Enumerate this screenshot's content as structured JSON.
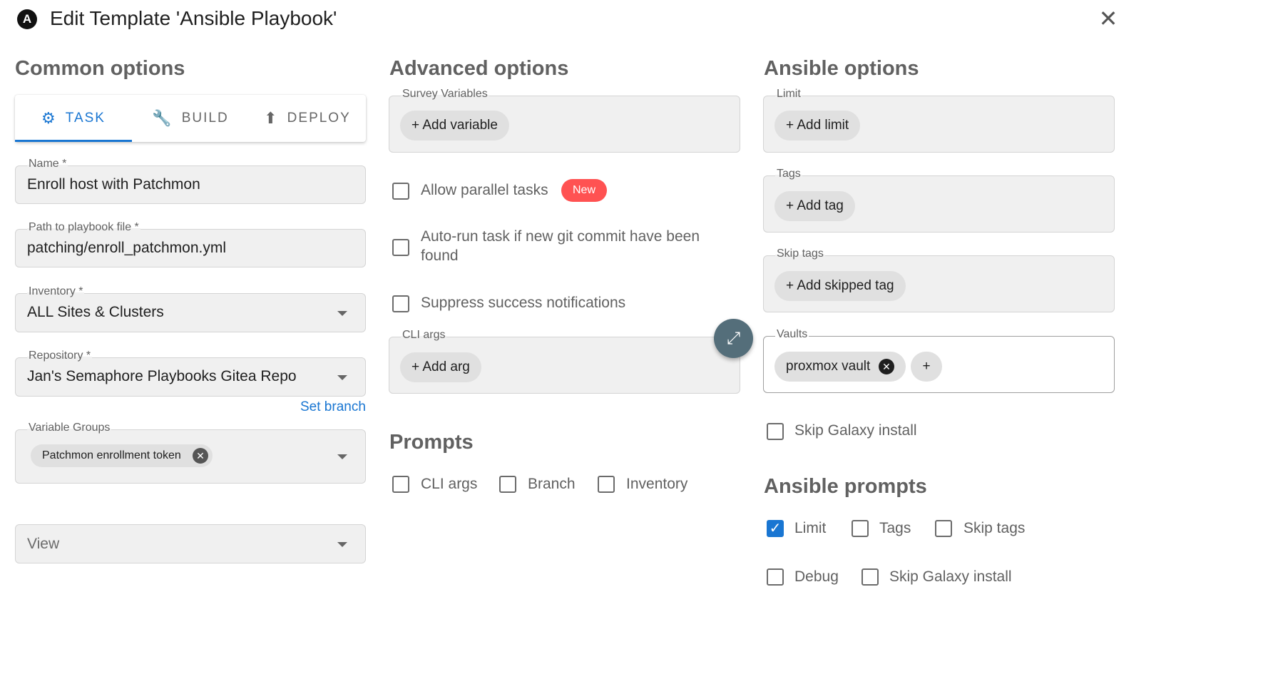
{
  "header": {
    "logo_letter": "A",
    "title": "Edit Template 'Ansible Playbook'",
    "close_icon": "close-icon"
  },
  "common": {
    "title": "Common options",
    "tabs": [
      {
        "label": "TASK",
        "icon": "gear-icon",
        "active": true
      },
      {
        "label": "BUILD",
        "icon": "wrench-icon",
        "active": false
      },
      {
        "label": "DEPLOY",
        "icon": "upload-icon",
        "active": false
      }
    ],
    "name": {
      "label": "Name *",
      "value": "Enroll host with Patchmon"
    },
    "playbook": {
      "label": "Path to playbook file *",
      "value": "patching/enroll_patchmon.yml"
    },
    "inventory": {
      "label": "Inventory *",
      "value": "ALL Sites & Clusters"
    },
    "repository": {
      "label": "Repository *",
      "value": "Jan's Semaphore Playbooks Gitea Repo"
    },
    "set_branch": "Set branch",
    "variable_groups": {
      "label": "Variable Groups",
      "chip": "Patchmon enrollment token"
    },
    "view": {
      "placeholder": "View"
    }
  },
  "advanced": {
    "title": "Advanced options",
    "survey": {
      "label": "Survey Variables",
      "button": "+ Add variable"
    },
    "allow_parallel": {
      "label": "Allow parallel tasks",
      "badge": "New",
      "checked": false
    },
    "autorun": {
      "label_line1": "Auto-run task if new git commit have been",
      "label_line2": "found",
      "checked": false
    },
    "suppress": {
      "label": "Suppress success notifications",
      "checked": false
    },
    "cli_args": {
      "label": "CLI args",
      "button": "+ Add arg"
    },
    "prompts_title": "Prompts",
    "prompts": [
      {
        "label": "CLI args",
        "checked": false
      },
      {
        "label": "Branch",
        "checked": false
      },
      {
        "label": "Inventory",
        "checked": false
      }
    ]
  },
  "ansible": {
    "title": "Ansible options",
    "limit": {
      "label": "Limit",
      "button": "+ Add limit"
    },
    "tags": {
      "label": "Tags",
      "button": "+ Add tag"
    },
    "skip_tags": {
      "label": "Skip tags",
      "button": "+ Add skipped tag"
    },
    "vaults": {
      "label": "Vaults",
      "chip": "proxmox vault",
      "add": "+"
    },
    "skip_galaxy": {
      "label": "Skip Galaxy install",
      "checked": false
    },
    "prompts_title": "Ansible prompts",
    "prompts_row1": [
      {
        "label": "Limit",
        "checked": true
      },
      {
        "label": "Tags",
        "checked": false
      },
      {
        "label": "Skip tags",
        "checked": false
      }
    ],
    "prompts_row2": [
      {
        "label": "Debug",
        "checked": false
      },
      {
        "label": "Skip Galaxy install",
        "checked": false
      }
    ]
  },
  "colors": {
    "accent": "#1976d2",
    "badge": "#ff5252",
    "fab": "#546e7a"
  }
}
